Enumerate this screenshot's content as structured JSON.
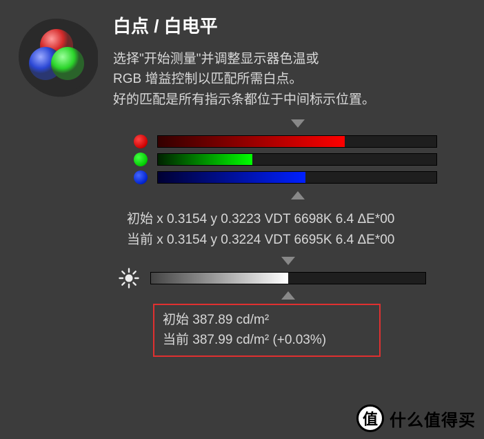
{
  "header": {
    "title": "白点 / 白电平",
    "desc_line1": "选择\"开始测量\"并调整显示器色温或",
    "desc_line2": "RGB 增益控制以匹配所需白点。",
    "desc_line3": "好的匹配是所有指示条都位于中间标示位置。"
  },
  "chart_data": {
    "type": "bar",
    "orientation": "horizontal",
    "target_position_pct": 50,
    "channels": [
      {
        "name": "red",
        "value_pct": 67,
        "color": "#ff0000"
      },
      {
        "name": "green",
        "value_pct": 34,
        "color": "#00ff00"
      },
      {
        "name": "blue",
        "value_pct": 53,
        "color": "#0020ff"
      }
    ],
    "brightness": {
      "value_pct": 50,
      "target_pct": 50,
      "gradient_from": "#444",
      "gradient_to": "#fff"
    }
  },
  "readout": {
    "initial": "初始 x 0.3154 y 0.3223 VDT 6698K 6.4 ΔE*00",
    "current": "当前 x 0.3154 y 0.3224 VDT 6695K 6.4 ΔE*00"
  },
  "info_box": {
    "initial": "初始 387.89 cd/m²",
    "current": "当前 387.99 cd/m² (+0.03%)"
  },
  "watermark": {
    "badge": "值",
    "text": "什么值得买"
  }
}
